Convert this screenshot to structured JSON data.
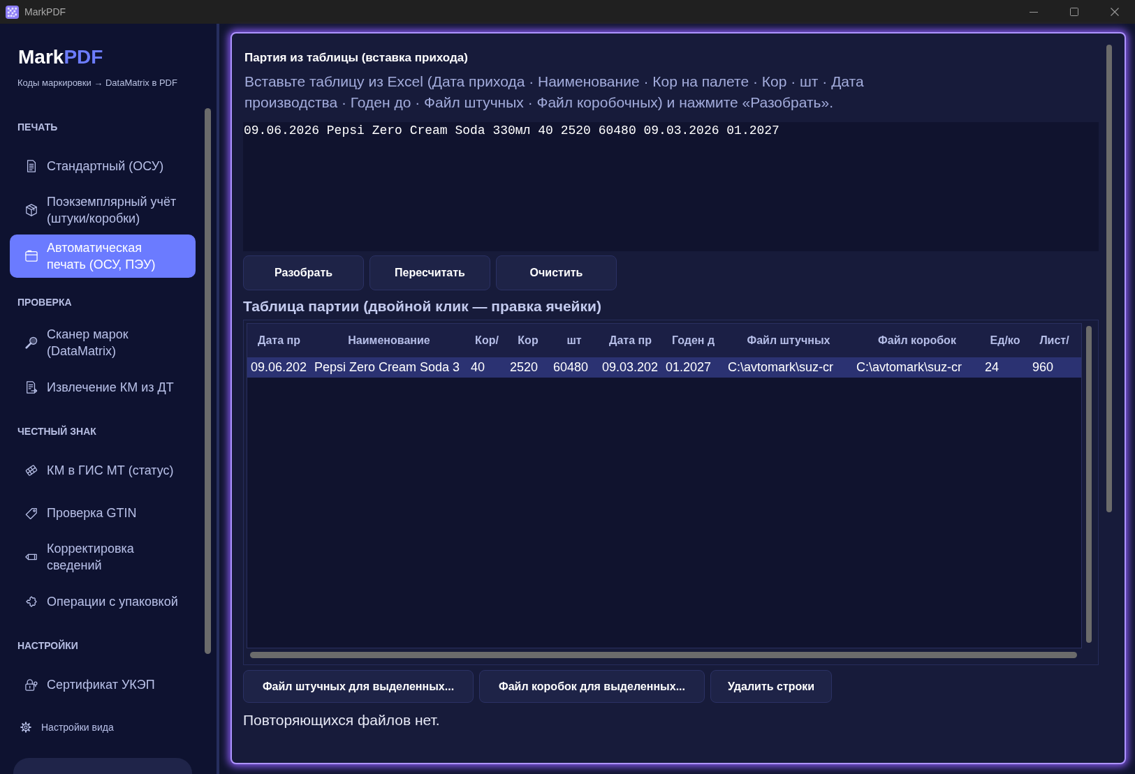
{
  "window": {
    "title": "MarkPDF"
  },
  "sidebar": {
    "logo": {
      "primary": "Mark",
      "accent": "PDF"
    },
    "tagline": "Коды маркировки → DataMatrix в PDF",
    "sections": [
      {
        "title": "ПЕЧАТЬ",
        "items": [
          {
            "label": "Стандартный (ОСУ)",
            "selected": false
          },
          {
            "label": "Поэкземплярный учёт (штуки/коробки)",
            "selected": false
          },
          {
            "label": "Автоматическая печать (ОСУ, ПЭУ)",
            "selected": true
          }
        ]
      },
      {
        "title": "ПРОВЕРКА",
        "items": [
          {
            "label": "Сканер марок (DataMatrix)",
            "selected": false
          },
          {
            "label": "Извлечение КМ из ДТ",
            "selected": false
          }
        ]
      },
      {
        "title": "ЧЕСТНЫЙ ЗНАК",
        "items": [
          {
            "label": "КМ в ГИС МТ (статус)",
            "selected": false
          },
          {
            "label": "Проверка GTIN",
            "selected": false
          },
          {
            "label": "Корректировка сведений",
            "selected": false
          },
          {
            "label": "Операции с упаковкой",
            "selected": false
          }
        ]
      },
      {
        "title": "НАСТРОЙКИ",
        "items": [
          {
            "label": "Сертификат УКЭП",
            "selected": false
          }
        ]
      }
    ],
    "footer_link": "Настройки вида"
  },
  "panel": {
    "title": "Партия из таблицы (вставка прихода)",
    "description": "Вставьте таблицу из Excel (Дата прихода · Наименование · Кор на палете · Кор · шт · Дата производства · Годен до · Файл штучных · Файл коробочных) и нажмите «Разобрать».",
    "paste_field": {
      "value": "09.06.2026 Pepsi Zero Cream Soda 330мл 40 2520 60480 09.03.2026 01.2027"
    },
    "buttons": [
      "Разобрать",
      "Пересчитать",
      "Очистить"
    ],
    "table_title": "Таблица партии (двойной клик — правка ячейки)",
    "table": {
      "columns": [
        "Дата пр",
        "Наименование",
        "Кор/",
        "Кор",
        "шт",
        "Дата пр",
        "Годен д",
        "Файл штучных",
        "Файл коробок",
        "Ед/ко",
        "Лист/"
      ],
      "rows": [
        {
          "selected": true,
          "cells": [
            "09.06.202",
            "Pepsi Zero Cream Soda 3",
            "40",
            "2520",
            "60480",
            "09.03.202",
            "01.2027",
            "C:\\avtomark\\suz-cr",
            "C:\\avtomark\\suz-cr",
            "24",
            "960"
          ]
        }
      ]
    },
    "row_buttons": [
      "Файл штучных для выделенных...",
      "Файл коробок для выделенных...",
      "Удалить строки"
    ],
    "status": "Повторяющихся файлов нет."
  }
}
